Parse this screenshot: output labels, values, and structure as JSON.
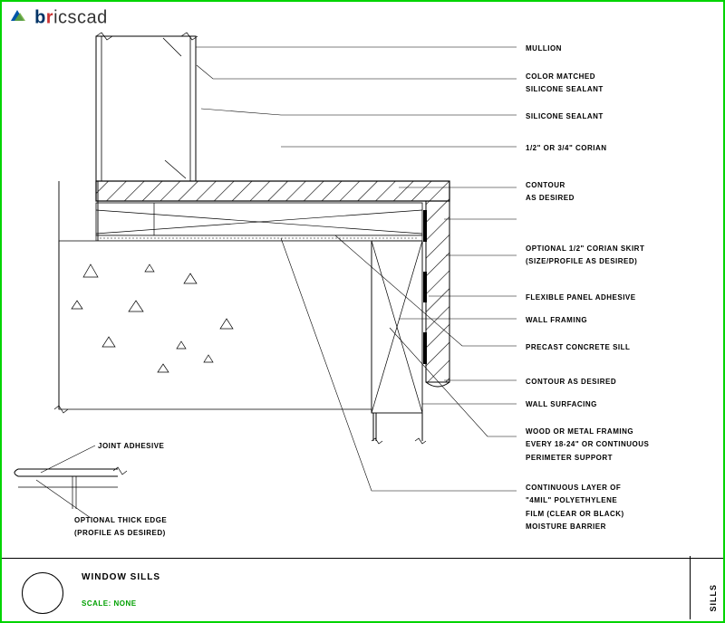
{
  "header": {
    "logo_text": "bricscad"
  },
  "labels": {
    "l1": "MULLION",
    "l2a": "COLOR MATCHED",
    "l2b": "SILICONE SEALANT",
    "l3": "SILICONE SEALANT",
    "l4": "1/2\" OR 3/4\" CORIAN",
    "l5a": "CONTOUR",
    "l5b": "AS DESIRED",
    "l6a": "OPTIONAL 1/2\" CORIAN SKIRT",
    "l6b": "(SIZE/PROFILE AS DESIRED)",
    "l7": "FLEXIBLE PANEL ADHESIVE",
    "l8": "WALL FRAMING",
    "l9": "PRECAST CONCRETE SILL",
    "l10": "CONTOUR AS DESIRED",
    "l11": "WALL SURFACING",
    "l12a": "WOOD OR METAL FRAMING",
    "l12b": "EVERY 18-24\" OR CONTINUOUS",
    "l12c": "PERIMETER SUPPORT",
    "l13a": "CONTINUOUS LAYER OF",
    "l13b": "\"4MIL\" POLYETHYLENE",
    "l13c": "FILM (CLEAR OR BLACK)",
    "l13d": "MOISTURE BARRIER",
    "detail1": "JOINT ADHESIVE",
    "detail2a": "OPTIONAL THICK EDGE",
    "detail2b": "(PROFILE AS DESIRED)"
  },
  "title_block": {
    "title": "WINDOW SILLS",
    "scale": "SCALE: NONE",
    "side": "SILLS"
  }
}
